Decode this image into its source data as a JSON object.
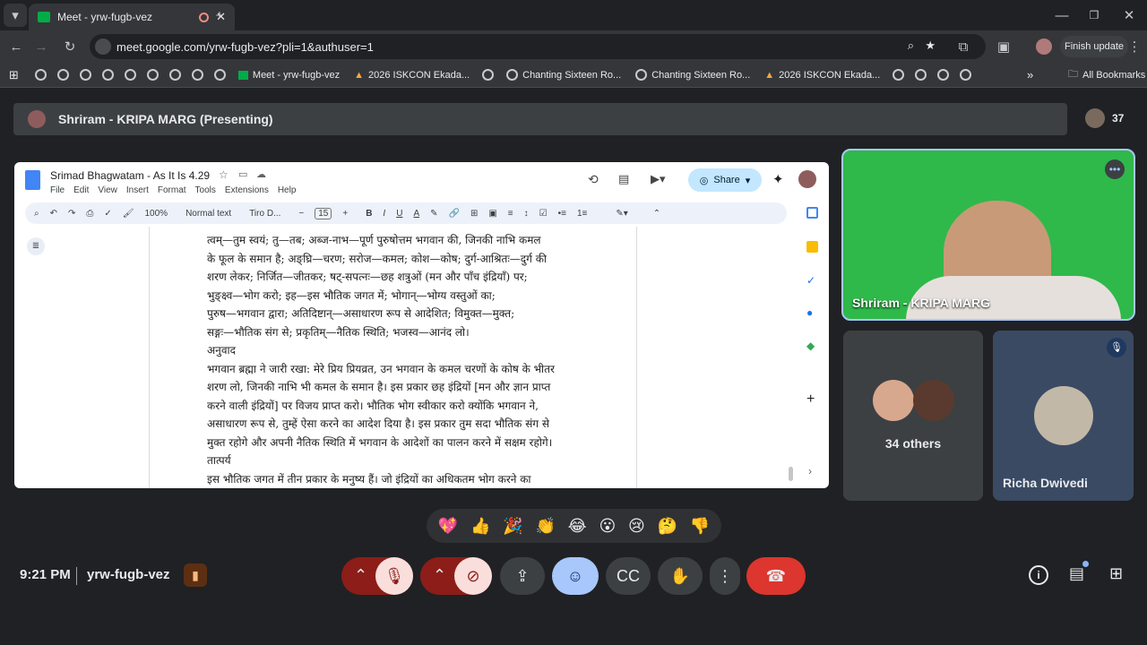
{
  "browser": {
    "tab_title": "Meet - yrw-fugb-vez",
    "url": "meet.google.com/yrw-fugb-vez?pli=1&authuser=1",
    "finish_update": "Finish update",
    "bookmarks": [
      "Meet - yrw-fugb-vez",
      "2026 ISKCON Ekada...",
      "Chanting Sixteen Ro...",
      "Chanting Sixteen Ro...",
      "2026 ISKCON Ekada..."
    ],
    "all_bookmarks": "All Bookmarks"
  },
  "meet": {
    "presenting_title": "Shriram - KRIPA MARG (Presenting)",
    "participant_count": "37",
    "main_tile_name": "Shriram - KRIPA MARG",
    "others_label": "34 others",
    "richa_name": "Richa Dwivedi",
    "time": "9:21 PM",
    "meeting_code": "yrw-fugb-vez",
    "reactions": [
      "💖",
      "👍",
      "🎉",
      "👏",
      "😂",
      "😮",
      "😢",
      "🤔",
      "👎"
    ]
  },
  "doc": {
    "title": "Srimad Bhagwatam - As It Is 4.29",
    "menu": [
      "File",
      "Edit",
      "View",
      "Insert",
      "Format",
      "Tools",
      "Extensions",
      "Help"
    ],
    "share": "Share",
    "zoom": "100%",
    "style": "Normal text",
    "font": "Tiro D...",
    "font_size": "15",
    "lines": [
      "त्वम्—तुम स्वयं; तु—तब; अब्ज-नाभ—पूर्ण पुरुषोत्तम भगवान की, जिनकी नाभि कमल",
      "के फूल के समान है; अङ्घ्रि—चरण; सरोज—कमल; कोश—कोष; दुर्ग-आश्रितः—दुर्ग की",
      "शरण लेकर; निर्जित—जीतकर; षट्-सपत्नः—छह शत्रुओं (मन और पाँच इंद्रियाँ) पर;",
      "भुङ्क्ष्व—भोग करो; इह—इस भौतिक जगत में; भोगान्—भोग्य वस्तुओं का;",
      "पुरुष—भगवान द्वारा; अतिदिष्टान्—असाधारण रूप से आदेशित; विमुक्त—मुक्त;",
      "सङ्गः—भौतिक संग से; प्रकृतिम्—नैतिक स्थिति; भजस्व—आनंद लो।",
      "अनुवाद",
      "भगवान ब्रह्मा ने जारी रखा: मेरे प्रिय प्रियव्रत, उन भगवान के कमल चरणों के कोष के भीतर",
      "शरण लो, जिनकी नाभि भी कमल के समान है। इस प्रकार छह इंद्रियों [मन और ज्ञान प्राप्त",
      "करने वाली इंद्रियों] पर विजय प्राप्त करो। भौतिक भोग स्वीकार करो क्योंकि भगवान ने,",
      "असाधारण रूप से, तुम्हें ऐसा करने का आदेश दिया है। इस प्रकार तुम सदा भौतिक संग से",
      "मुक्त रहोगे और अपनी नैतिक स्थिति में भगवान के आदेशों का पालन करने में सक्षम रहोगे।",
      "तात्पर्य",
      "इस भौतिक जगत में तीन प्रकार के मनुष्य हैं। जो इंद्रियों का अधिकतम भोग करने का"
    ]
  }
}
